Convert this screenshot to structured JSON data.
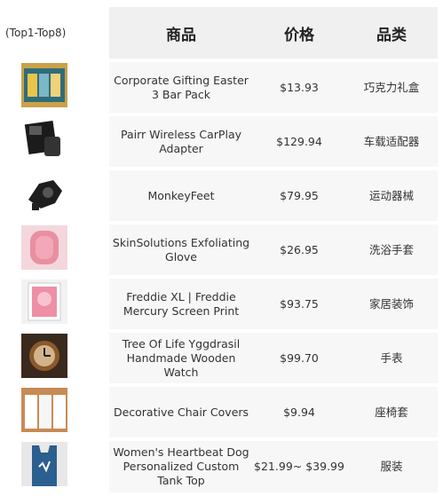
{
  "caption": "(Top1-Top8)",
  "headers": {
    "product": "商品",
    "price": "价格",
    "category": "品类"
  },
  "rows": [
    {
      "product": "Corporate Gifting Easter 3 Bar Pack",
      "price": "$13.93",
      "category": "巧克力礼盒",
      "image": "chocolate-gift-box-image"
    },
    {
      "product": "Pairr Wireless CarPlay Adapter",
      "price": "$129.94",
      "category": "车载适配器",
      "image": "carplay-adapter-image"
    },
    {
      "product": "MonkeyFeet",
      "price": "$79.95",
      "category": "运动器械",
      "image": "monkeyfeet-image"
    },
    {
      "product": "SkinSolutions Exfoliating Glove",
      "price": "$26.95",
      "category": "洗浴手套",
      "image": "exfoliating-glove-image"
    },
    {
      "product": "Freddie XL | Freddie Mercury Screen Print",
      "price": "$93.75",
      "category": "家居装饰",
      "image": "screen-print-image"
    },
    {
      "product": "Tree Of Life Yggdrasil Handmade Wooden Watch",
      "price": "$99.70",
      "category": "手表",
      "image": "wooden-watch-image"
    },
    {
      "product": "Decorative Chair Covers",
      "price": "$9.94",
      "category": "座椅套",
      "image": "chair-covers-image"
    },
    {
      "product": "Women's Heartbeat Dog Personalized Custom Tank Top",
      "price": "$21.99~ $39.99",
      "category": "服装",
      "image": "tank-top-image"
    }
  ]
}
